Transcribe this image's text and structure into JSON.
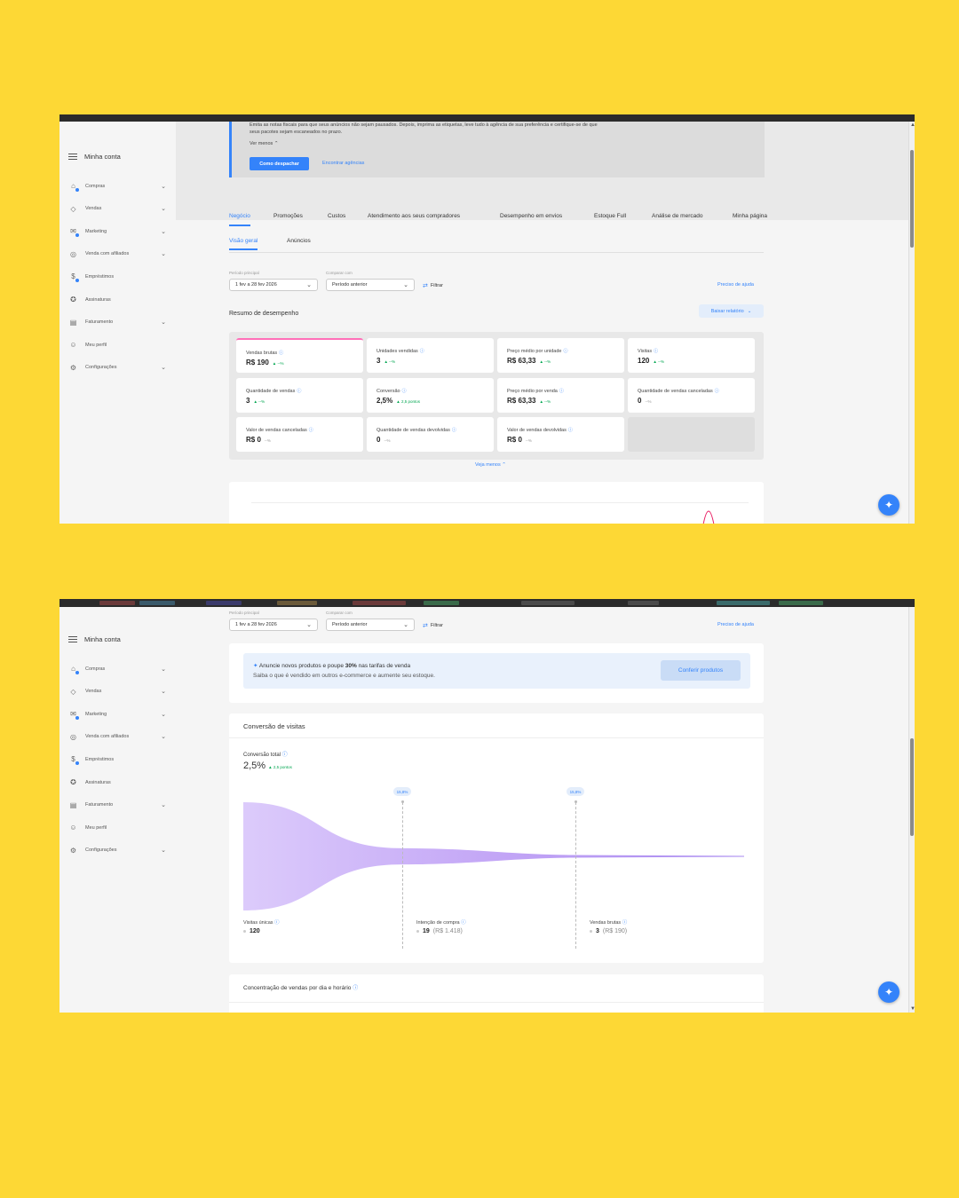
{
  "sidebar": {
    "title": "Minha conta",
    "items": [
      {
        "label": "Compras",
        "icon": "bag-icon",
        "chevron": true,
        "dot": true
      },
      {
        "label": "Vendas",
        "icon": "tag-icon",
        "chevron": true,
        "dot": false
      },
      {
        "label": "Marketing",
        "icon": "megaphone-icon",
        "chevron": true,
        "dot": true
      },
      {
        "label": "Venda com afiliados",
        "icon": "affiliate-icon",
        "chevron": true,
        "dot": false
      },
      {
        "label": "Empréstimos",
        "icon": "loan-icon",
        "chevron": false,
        "dot": true
      },
      {
        "label": "Assinaturas",
        "icon": "subscription-icon",
        "chevron": false,
        "dot": false
      },
      {
        "label": "Faturamento",
        "icon": "invoice-icon",
        "chevron": true,
        "dot": false
      },
      {
        "label": "Meu perfil",
        "icon": "profile-icon",
        "chevron": false,
        "dot": false
      },
      {
        "label": "Configurações",
        "icon": "gear-icon",
        "chevron": true,
        "dot": false
      }
    ]
  },
  "notice": {
    "line1": "Emita as notas fiscais para que seus anúncios não sejam pausados. Depois, imprima as etiquetas, leve tudo à agência de sua preferência e certifique-se de que",
    "line2": "seus pacotes sejam escaneados no prazo.",
    "see_less": "Ver menos",
    "primary_button": "Como despachar",
    "secondary_link": "Encontrar agências"
  },
  "main_tabs": [
    "Negócio",
    "Promoções",
    "Custos",
    "Atendimento aos seus compradores",
    "Desempenho em envios",
    "Estoque Full",
    "Análise de mercado",
    "Minha página"
  ],
  "sub_tabs": [
    "Visão geral",
    "Anúncios"
  ],
  "filters": {
    "period_label": "Período principal",
    "period_value": "1 fev a 28 fev 2026",
    "compare_label": "Comparar com",
    "compare_value": "Período anterior",
    "filter_label": "Filtrar",
    "help_link": "Preciso de ajuda"
  },
  "performance": {
    "title": "Resumo de desempenho",
    "download_button": "Baixar relatório",
    "see_less": "Veja menos",
    "kpis": [
      {
        "label": "Vendas brutas",
        "value": "R$ 190",
        "delta": "▲ --%",
        "positive": true
      },
      {
        "label": "Unidades vendidas",
        "value": "3",
        "delta": "▲ --%",
        "positive": true
      },
      {
        "label": "Preço médio por unidade",
        "value": "R$ 63,33",
        "delta": "▲ --%",
        "positive": true
      },
      {
        "label": "Visitas",
        "value": "120",
        "delta": "▲ --%",
        "positive": true
      },
      {
        "label": "Quantidade de vendas",
        "value": "3",
        "delta": "▲ --%",
        "positive": true
      },
      {
        "label": "Conversão",
        "value": "2,5%",
        "delta": "▲ 2,5 pontos",
        "positive": true
      },
      {
        "label": "Preço médio por venda",
        "value": "R$ 63,33",
        "delta": "▲ --%",
        "positive": true
      },
      {
        "label": "Quantidade de vendas canceladas",
        "value": "0",
        "delta": "--%",
        "positive": false
      },
      {
        "label": "Valor de vendas canceladas",
        "value": "R$ 0",
        "delta": "--%",
        "positive": false
      },
      {
        "label": "Quantidade de vendas devolvidas",
        "value": "0",
        "delta": "--%",
        "positive": false
      },
      {
        "label": "Valor de vendas devolvidas",
        "value": "R$ 0",
        "delta": "--%",
        "positive": false
      }
    ]
  },
  "promo": {
    "prefix": "Anuncie novos produtos e poupe ",
    "highlight": "30%",
    "suffix": " nas tarifas de venda",
    "subtitle": "Saiba o que é vendido em outros e-commerce e aumente seu estoque.",
    "button": "Conferir produtos"
  },
  "conversion": {
    "title": "Conversão de visitas",
    "total_label": "Conversão total",
    "total_value": "2,5%",
    "total_delta": "▲ 2,5 pontos",
    "chart_data": {
      "type": "area",
      "stages": [
        {
          "label": "Visitas únicas",
          "value": 120,
          "display": "120",
          "extra": ""
        },
        {
          "label": "Intenção de compra",
          "value": 19,
          "display": "19",
          "extra": "(R$ 1.418)"
        },
        {
          "label": "Vendas brutas",
          "value": 3,
          "display": "3",
          "extra": "(R$ 190)"
        }
      ],
      "step_rates": [
        "15,8%",
        "15,8%"
      ]
    }
  },
  "heatmap_section": {
    "title": "Concentração de vendas por dia e horário"
  },
  "colors": {
    "background": "#FDD835",
    "accent": "#3483fa",
    "positive": "#00a650",
    "highlight_border": "#ff6fb8",
    "funnel": "#c7a6f7"
  }
}
